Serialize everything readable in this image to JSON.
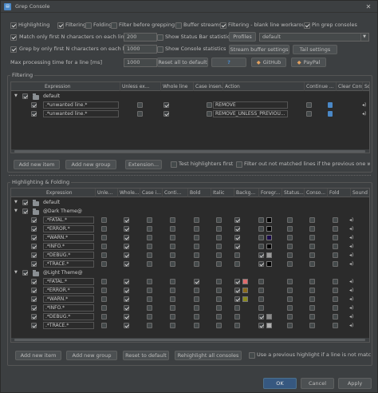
{
  "window": {
    "title": "Grep Console",
    "close": "✕"
  },
  "top": {
    "row1": [
      {
        "label": "Highlighting",
        "checked": true
      },
      {
        "label": "Filtering",
        "checked": true
      },
      {
        "label": "Folding",
        "checked": false
      },
      {
        "label": "Filter before grepping",
        "checked": false
      },
      {
        "label": "Buffer streams",
        "checked": false
      },
      {
        "label": "Filtering - blank line workaround",
        "checked": true
      },
      {
        "label": "Pin grep consoles",
        "checked": true
      }
    ],
    "match_first": {
      "label": "Match only first N characters on each line",
      "value": "200",
      "checked": true
    },
    "grep_first": {
      "label": "Grep by only first N characters on each line",
      "value": "1000",
      "checked": true
    },
    "max_time": {
      "label": "Max processing time for a line [ms]",
      "value": "1000"
    },
    "show_status": {
      "label": "Show Status Bar statistics",
      "checked": false
    },
    "show_console": {
      "label": "Show Console statistics",
      "checked": false
    },
    "profiles_label": "Profiles",
    "profile_value": "default",
    "stream_buffer": "Stream buffer settings",
    "tail_settings": "Tail settings",
    "reset_all": "Reset all to default",
    "help": "?",
    "github": "GitHub",
    "paypal": "PayPal"
  },
  "filtering": {
    "section": "Filtering",
    "columns": [
      "Expression",
      "Unless ex...",
      "Whole line",
      "Case insen...",
      "Action",
      "Continue ...",
      "Clear Conso...",
      "Sou"
    ],
    "group": "default",
    "rows": [
      {
        "expr": ".*unwanted line.*",
        "whole": true,
        "action": "REMOVE"
      },
      {
        "expr": ".*unwanted line.*",
        "whole": true,
        "action": "REMOVE_UNLESS_PREVIOU..."
      }
    ],
    "buttons": {
      "add_item": "Add new item",
      "add_group": "Add new group",
      "extension": "Extension..."
    },
    "test_first": "Test highlighters first",
    "filter_out": "Filter out not matched lines if the previous one was fil"
  },
  "highlighting": {
    "section": "Highlighting & Folding",
    "columns": [
      "Expression",
      "Unle...",
      "Whole...",
      "Case i...",
      "Conti...",
      "Bold",
      "Italic",
      "Backg...",
      "Foregr...",
      "Status...",
      "Conso...",
      "Fold",
      "Sound"
    ],
    "group_default": "default",
    "groups": [
      {
        "name": "@Dark Theme@",
        "rows": [
          {
            "expr": ".*FATAL.*",
            "bold": false,
            "bg": "",
            "fg": "#000000",
            "bgon": true,
            "fgon": false
          },
          {
            "expr": ".*ERROR.*",
            "bold": false,
            "bg": "",
            "fg": "#000000",
            "bgon": true,
            "fgon": false
          },
          {
            "expr": ".*WARN.*",
            "bold": false,
            "bg": "",
            "fg": "#1a0a4a",
            "bgon": true,
            "fgon": false
          },
          {
            "expr": ".*INFO.*",
            "bold": false,
            "bg": "",
            "fg": "#000000",
            "bgon": true,
            "fgon": false
          },
          {
            "expr": ".*DEBUG.*",
            "bold": false,
            "bg": "",
            "fg": "#9a9a9a",
            "bgon": false,
            "fgon": true
          },
          {
            "expr": ".*TRACE.*",
            "bold": false,
            "bg": "",
            "fg": "#000000",
            "bgon": false,
            "fgon": true
          }
        ]
      },
      {
        "name": "@Light Theme@",
        "rows": [
          {
            "expr": ".*FATAL.*",
            "bold": true,
            "bg": "#e06c6c",
            "fg": "",
            "bgon": true,
            "fgon": false
          },
          {
            "expr": ".*ERROR.*",
            "bold": false,
            "bg": "#8a6a1a",
            "fg": "",
            "bgon": true,
            "fgon": false
          },
          {
            "expr": ".*WARN.*",
            "bold": false,
            "bg": "#8a8a1a",
            "fg": "",
            "bgon": true,
            "fgon": false
          },
          {
            "expr": ".*INFO.*",
            "bold": false,
            "bg": "",
            "fg": "",
            "bgon": false,
            "fgon": false
          },
          {
            "expr": ".*DEBUG.*",
            "bold": false,
            "bg": "",
            "fg": "#8a8a8a",
            "bgon": false,
            "fgon": true
          },
          {
            "expr": ".*TRACE.*",
            "bold": false,
            "bg": "",
            "fg": "#b0b0b0",
            "bgon": false,
            "fgon": true
          }
        ]
      }
    ],
    "buttons": {
      "add_item": "Add new item",
      "add_group": "Add new group",
      "reset": "Reset to default",
      "rehighlight": "Rehighlight all consoles"
    },
    "use_prev": "Use a previous highlight if a line is not matched"
  },
  "footer": {
    "ok": "OK",
    "cancel": "Cancel",
    "apply": "Apply"
  }
}
